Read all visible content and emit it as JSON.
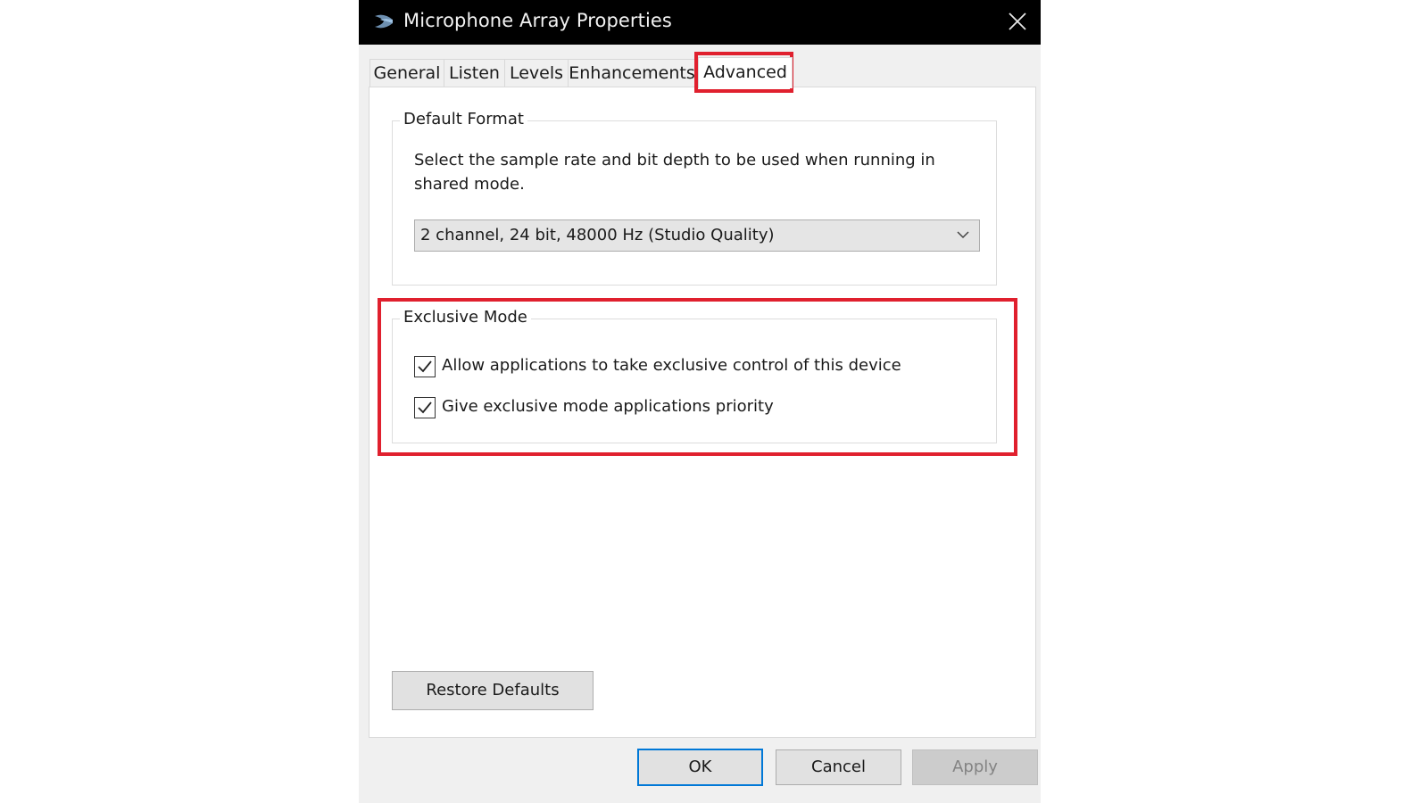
{
  "window": {
    "title": "Microphone Array Properties",
    "app_icon": "microphone-array-icon",
    "close_icon": "close-icon"
  },
  "tabs": [
    {
      "label": "General",
      "active": false
    },
    {
      "label": "Listen",
      "active": false
    },
    {
      "label": "Levels",
      "active": false
    },
    {
      "label": "Enhancements",
      "active": false
    },
    {
      "label": "Advanced",
      "active": true
    }
  ],
  "default_format": {
    "group_label": "Default Format",
    "description": "Select the sample rate and bit depth to be used when running in shared mode.",
    "selected_format": "2 channel, 24 bit, 48000 Hz (Studio Quality)",
    "dropdown_icon": "chevron-down-icon"
  },
  "exclusive_mode": {
    "group_label": "Exclusive Mode",
    "options": [
      {
        "label": "Allow applications to take exclusive control of this device",
        "checked": true
      },
      {
        "label": "Give exclusive mode applications priority",
        "checked": true
      }
    ]
  },
  "restore_defaults_label": "Restore Defaults",
  "footer": {
    "ok_label": "OK",
    "cancel_label": "Cancel",
    "apply_label": "Apply",
    "apply_enabled": false
  },
  "annotations": {
    "highlight_color": "#e0202e",
    "highlighted": [
      "Advanced tab",
      "Exclusive Mode group"
    ]
  }
}
